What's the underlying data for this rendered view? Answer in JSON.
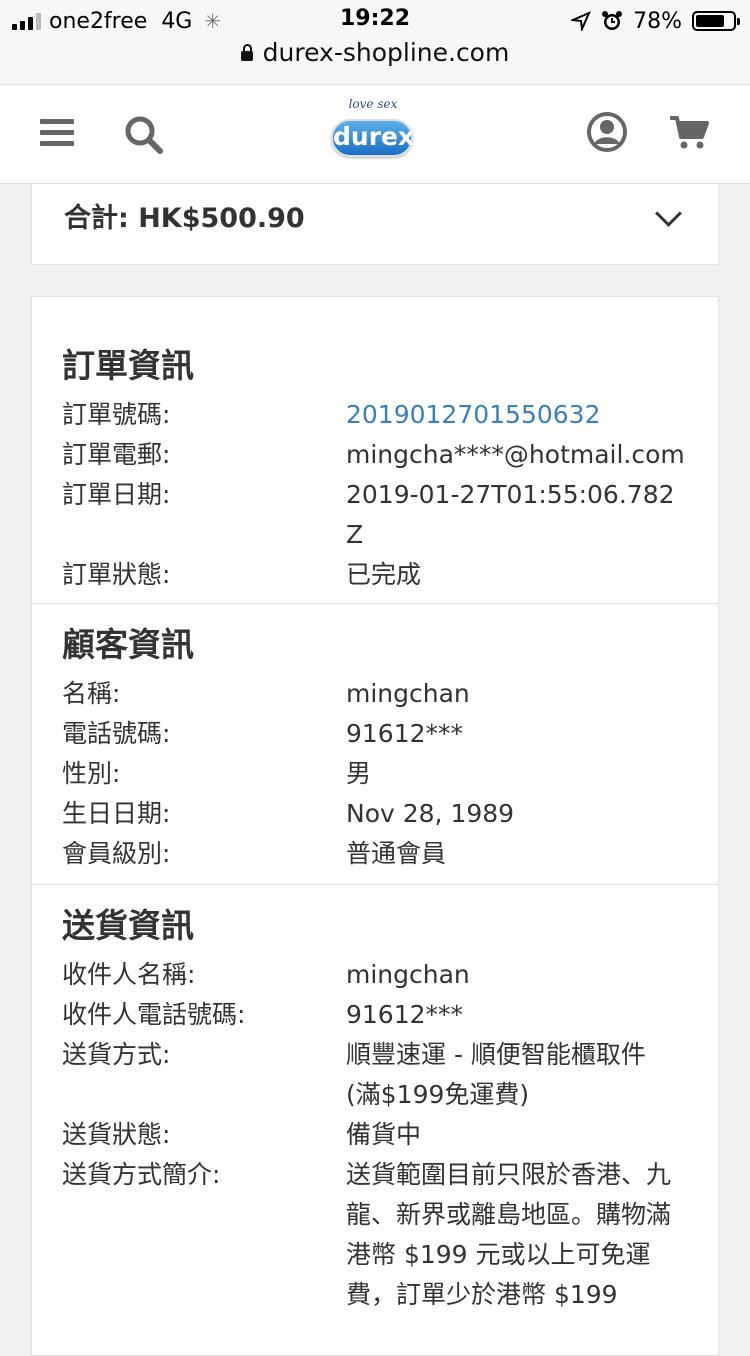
{
  "status_bar": {
    "carrier": "one2free",
    "network": "4G",
    "time": "19:22",
    "battery": "78%",
    "battery_level": 0.78,
    "url": "durex-shopline.com"
  },
  "header": {
    "logo_tagline": "love sex",
    "logo_text": "durex"
  },
  "total": {
    "text": "合計: HK$500.90"
  },
  "order_info": {
    "title": "訂單資訊",
    "rows": [
      {
        "label": "訂單號碼:",
        "value": "2019012701550632"
      },
      {
        "label": "訂單電郵:",
        "value": "mingcha****@hotmail.com"
      },
      {
        "label": "訂單日期:",
        "value": "2019-01-27T01:55:06.782Z"
      },
      {
        "label": "訂單狀態:",
        "value": "已完成"
      }
    ]
  },
  "customer_info": {
    "title": "顧客資訊",
    "rows": [
      {
        "label": "名稱:",
        "value": "mingchan"
      },
      {
        "label": "電話號碼:",
        "value": "91612***"
      },
      {
        "label": "性別:",
        "value": "男"
      },
      {
        "label": "生日日期:",
        "value": "Nov 28, 1989"
      },
      {
        "label": "會員級別:",
        "value": "普通會員"
      }
    ]
  },
  "delivery_info": {
    "title": "送貨資訊",
    "rows": [
      {
        "label": "收件人名稱:",
        "value": "mingchan"
      },
      {
        "label": "收件人電話號碼:",
        "value": "91612***"
      },
      {
        "label": "送貨方式:",
        "value": "順豐速運 - 順便智能櫃取件 (滿$199免運費)"
      },
      {
        "label": "送貨狀態:",
        "value": "備貨中"
      },
      {
        "label": "送貨方式簡介:",
        "value": "送貨範圍目前只限於香港、九龍、新界或離島地區。購物滿港幣 $199 元或以上可免運費，訂單少於港幣 $199"
      }
    ]
  }
}
